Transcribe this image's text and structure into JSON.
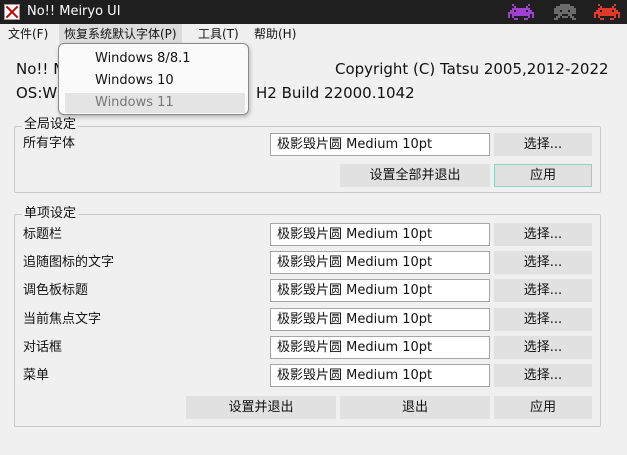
{
  "window": {
    "title": "No!! Meiryo UI",
    "controls": [
      {
        "name": "minimize-invader-icon",
        "color": "#a040d0"
      },
      {
        "name": "maximize-invader-icon",
        "color": "#6a6a6a"
      },
      {
        "name": "close-invader-icon",
        "color": "#e23a2a"
      }
    ]
  },
  "menubar": {
    "items": [
      {
        "label": "文件(F)"
      },
      {
        "label": "恢复系统默认字体(P)"
      },
      {
        "label": "工具(T)"
      },
      {
        "label": "帮助(H)"
      }
    ]
  },
  "dropdown": {
    "items": [
      {
        "label": "Windows 8/8.1",
        "enabled": true
      },
      {
        "label": "Windows 10",
        "enabled": true
      },
      {
        "label": "Windows 11",
        "enabled": false
      }
    ]
  },
  "info": {
    "app_name": "No!! Me",
    "copyright": "Copyright (C) Tatsu 2005,2012-2022",
    "os_prefix": "OS:Wi",
    "os_suffix": "H2 Build 22000.1042"
  },
  "global": {
    "label": "全局设定",
    "row_label": "所有字体",
    "font_value": "极影毁片圆 Medium  10pt",
    "select_label": "选择...",
    "set_all_exit_label": "设置全部并退出",
    "apply_label": "应用"
  },
  "items": {
    "label": "单项设定",
    "rows": [
      {
        "label": "标题栏",
        "font": "极影毁片圆 Medium  10pt",
        "button": "选择..."
      },
      {
        "label": "追随图标的文字",
        "font": "极影毁片圆 Medium  10pt",
        "button": "选择..."
      },
      {
        "label": "调色板标题",
        "font": "极影毁片圆 Medium  10pt",
        "button": "选择..."
      },
      {
        "label": "当前焦点文字",
        "font": "极影毁片圆 Medium  10pt",
        "button": "选择..."
      },
      {
        "label": "对话框",
        "font": "极影毁片圆 Medium  10pt",
        "button": "选择..."
      },
      {
        "label": "菜单",
        "font": "极影毁片圆 Medium  10pt",
        "button": "选择..."
      }
    ],
    "set_exit_label": "设置并退出",
    "exit_label": "退出",
    "apply_label": "应用"
  }
}
